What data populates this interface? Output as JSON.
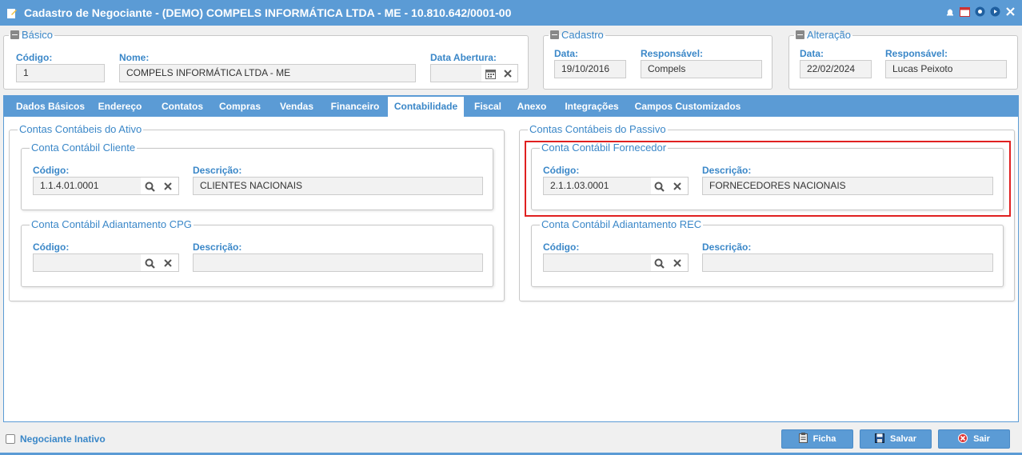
{
  "window": {
    "title": "Cadastro de Negociante - (DEMO) COMPELS INFORMÁTICA LTDA - ME - 10.810.642/0001-00"
  },
  "basico": {
    "legend": "Básico",
    "codigo_label": "Código:",
    "codigo_value": "1",
    "nome_label": "Nome:",
    "nome_value": "COMPELS INFORMÁTICA LTDA - ME",
    "data_abertura_label": "Data Abertura:",
    "data_abertura_value": ""
  },
  "cadastro": {
    "legend": "Cadastro",
    "data_label": "Data:",
    "data_value": "19/10/2016",
    "responsavel_label": "Responsável:",
    "responsavel_value": "Compels"
  },
  "alteracao": {
    "legend": "Alteração",
    "data_label": "Data:",
    "data_value": "22/02/2024",
    "responsavel_label": "Responsável:",
    "responsavel_value": "Lucas Peixoto"
  },
  "tabs": [
    {
      "label": "Dados Básicos"
    },
    {
      "label": "Endereço"
    },
    {
      "label": "Contatos"
    },
    {
      "label": "Compras"
    },
    {
      "label": "Vendas"
    },
    {
      "label": "Financeiro"
    },
    {
      "label": "Contabilidade"
    },
    {
      "label": "Fiscal"
    },
    {
      "label": "Anexo"
    },
    {
      "label": "Integrações"
    },
    {
      "label": "Campos Customizados"
    }
  ],
  "active_tab": "Contabilidade",
  "ativo": {
    "legend": "Contas Contábeis do Ativo",
    "cliente": {
      "legend": "Conta Contábil Cliente",
      "codigo_label": "Código:",
      "codigo_value": "1.1.4.01.0001",
      "descricao_label": "Descrição:",
      "descricao_value": "CLIENTES NACIONAIS"
    },
    "adiantamento": {
      "legend": "Conta Contábil Adiantamento CPG",
      "codigo_label": "Código:",
      "codigo_value": "",
      "descricao_label": "Descrição:",
      "descricao_value": ""
    }
  },
  "passivo": {
    "legend": "Contas Contábeis do Passivo",
    "fornecedor": {
      "legend": "Conta Contábil Fornecedor",
      "codigo_label": "Código:",
      "codigo_value": "2.1.1.03.0001",
      "descricao_label": "Descrição:",
      "descricao_value": "FORNECEDORES NACIONAIS"
    },
    "adiantamento": {
      "legend": "Conta Contábil Adiantamento REC",
      "codigo_label": "Código:",
      "codigo_value": "",
      "descricao_label": "Descrição:",
      "descricao_value": ""
    }
  },
  "footer": {
    "inativo_label": "Negociante Inativo",
    "ficha_label": "Ficha",
    "salvar_label": "Salvar",
    "sair_label": "Sair"
  },
  "colors": {
    "accent": "#5b9bd5",
    "label": "#3a87c8",
    "highlight": "#e02020"
  }
}
